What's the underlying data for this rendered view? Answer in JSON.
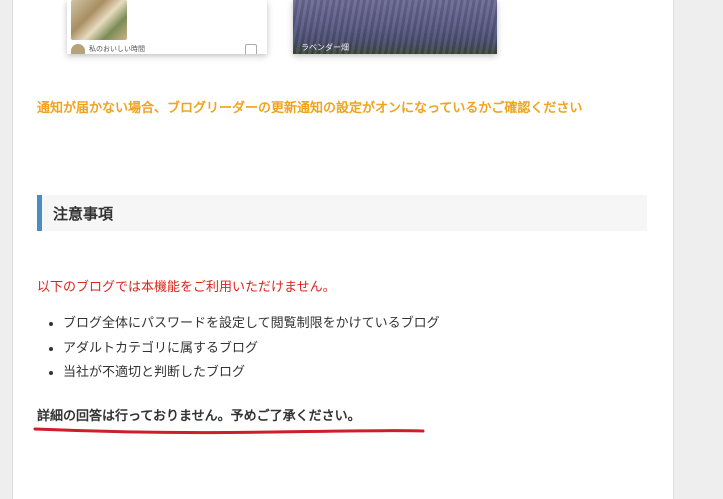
{
  "cards": [
    {
      "label": "私のおいしい時間"
    },
    {
      "label": "ラベンダー畑"
    }
  ],
  "notice": "通知が届かない場合、ブログリーダーの更新通知の設定がオンになっているかご確認ください",
  "section": {
    "title": "注意事項"
  },
  "warning": "以下のブログでは本機能をご利用いただけません。",
  "items": [
    "ブログ全体にパスワードを設定して閲覧制限をかけているブログ",
    "アダルトカテゴリに属するブログ",
    "当社が不適切と判断したブログ"
  ],
  "final_note": "詳細の回答は行っておりません。予めご了承ください。",
  "colors": {
    "notice": "#f0a31e",
    "warning": "#d9261c",
    "section_accent": "#4a8cc3",
    "annotation_underline": "#cc1f2a"
  }
}
